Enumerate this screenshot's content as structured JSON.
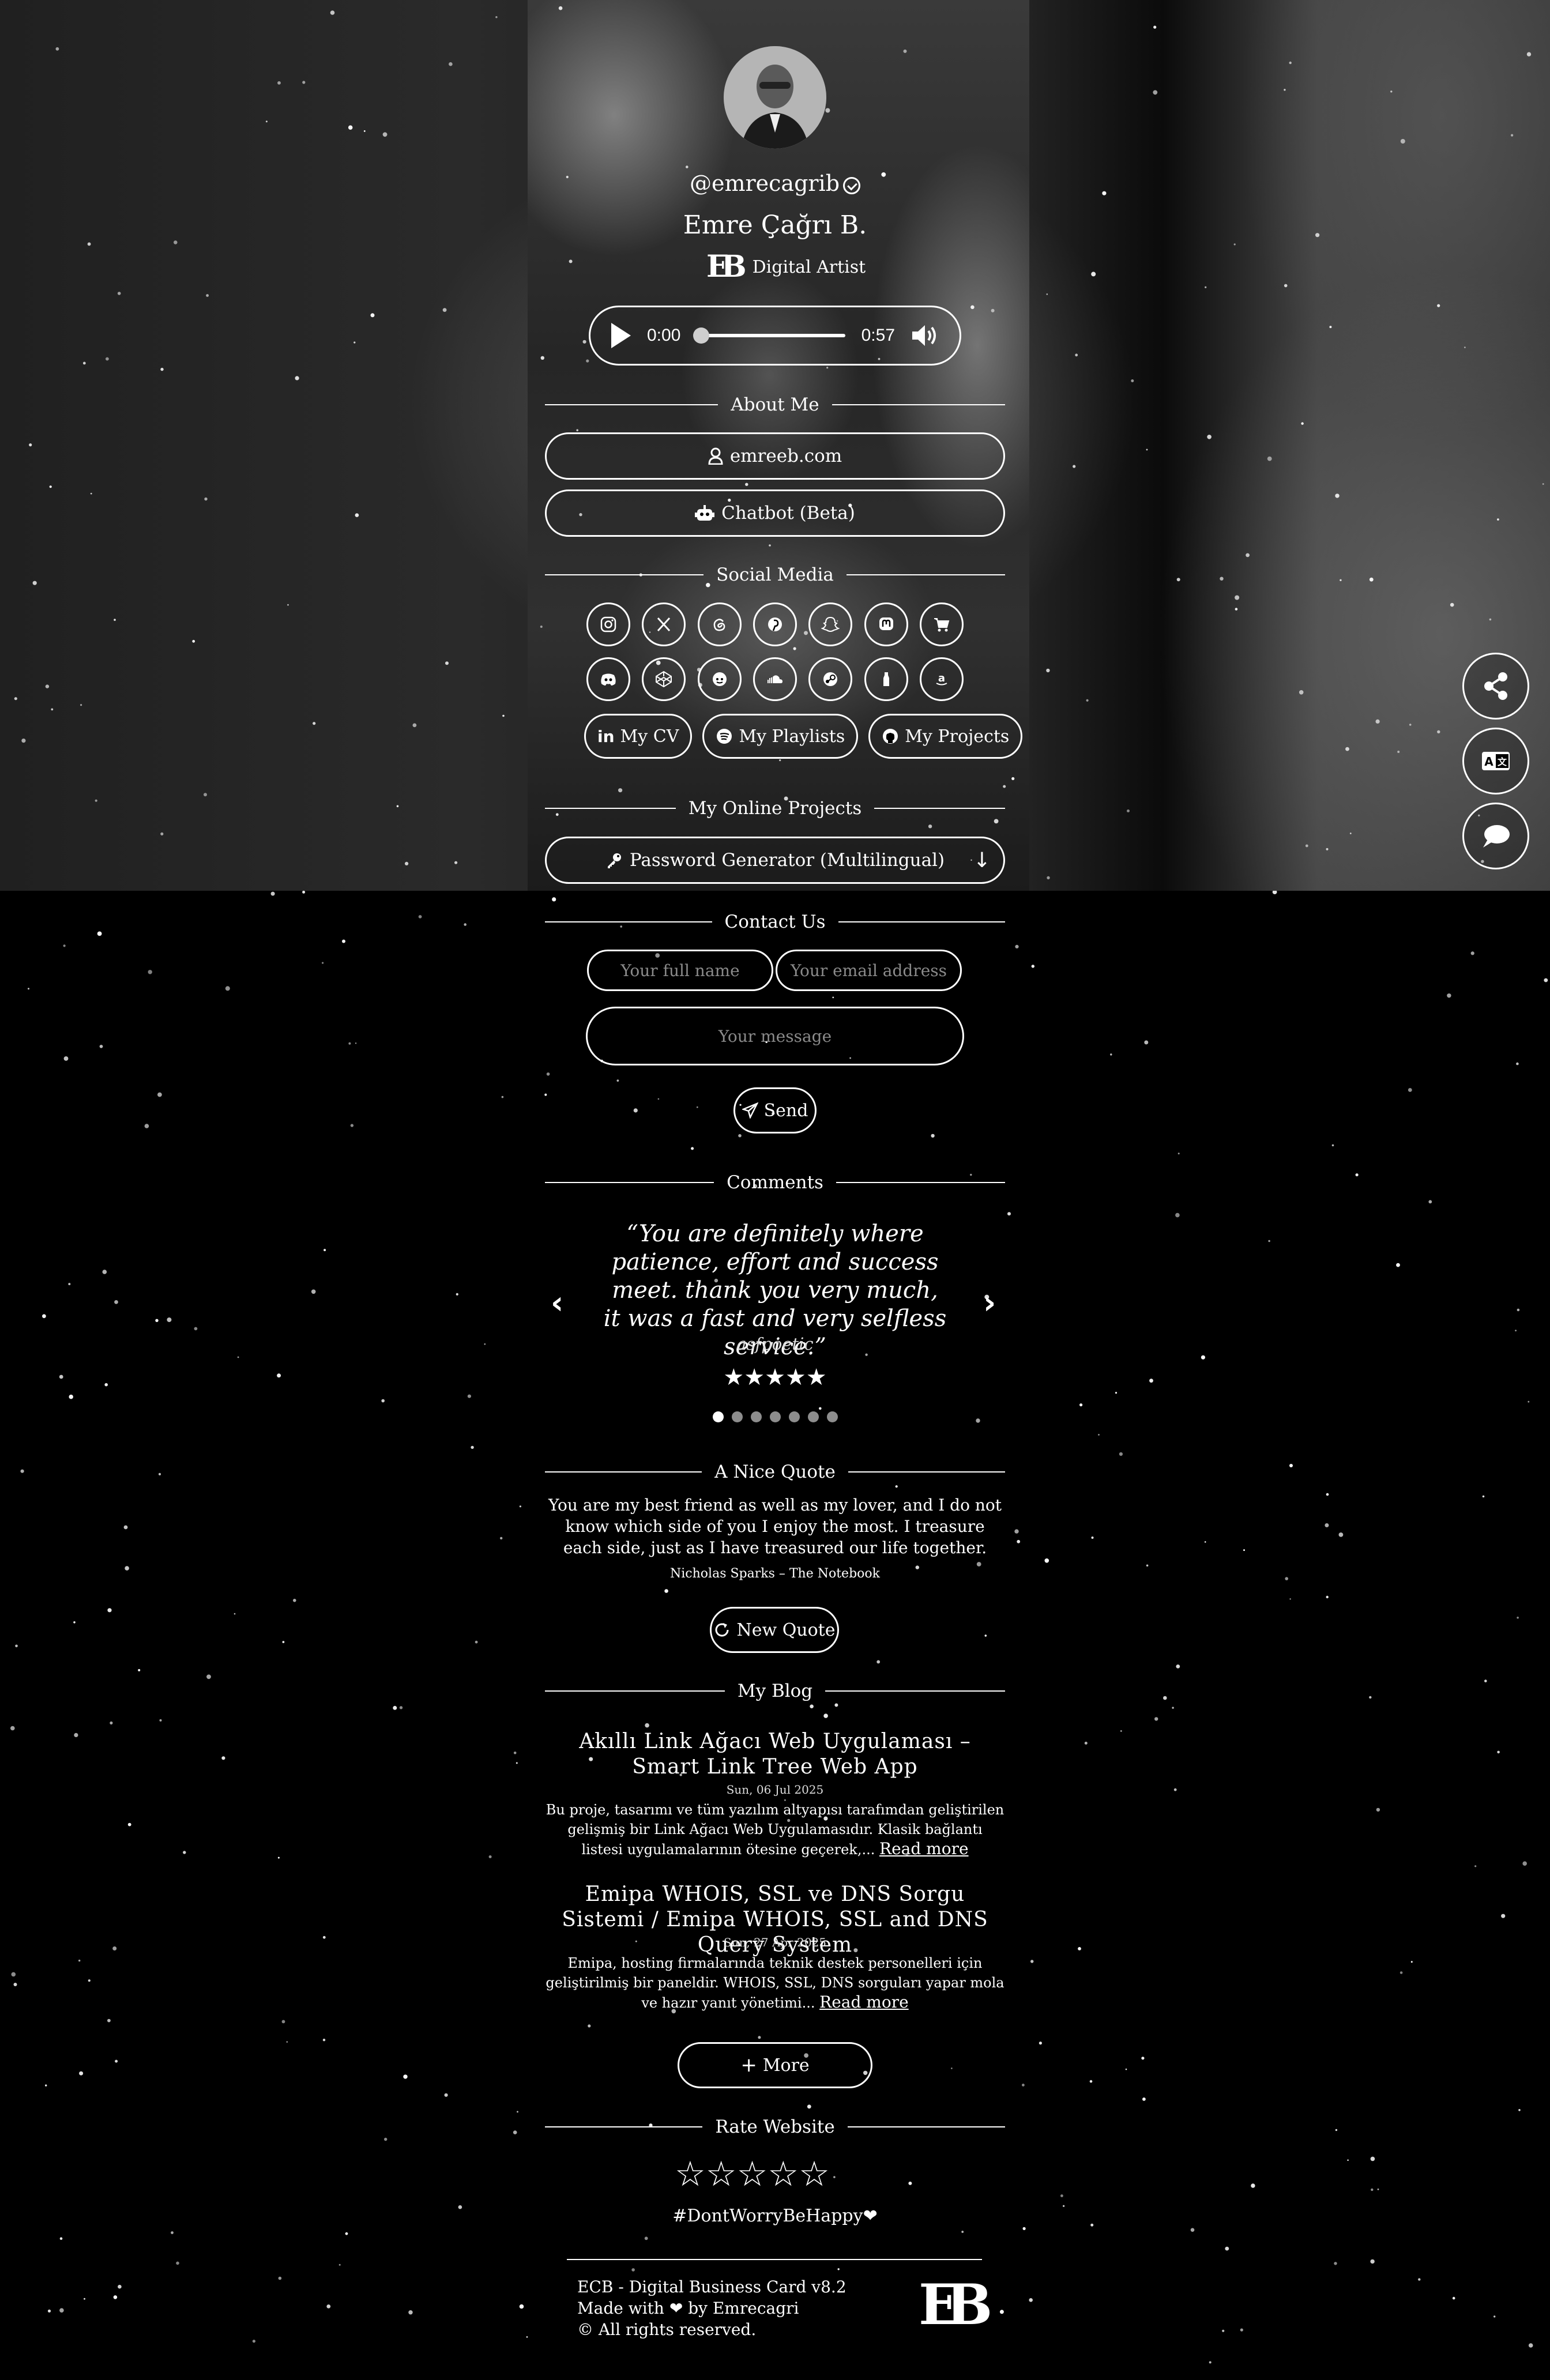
{
  "profile": {
    "username": "@emrecagrib",
    "name": "Emre Çağrı B.",
    "monogram": "EB",
    "title": "Digital Artist"
  },
  "player": {
    "current_time": "0:00",
    "duration": "0:57",
    "progress": 0
  },
  "sections": {
    "about": "About Me",
    "social": "Social Media",
    "projects": "My Online Projects",
    "contact": "Contact Us",
    "comments": "Comments",
    "quote": "A Nice Quote",
    "blog": "My Blog",
    "rate": "Rate Website"
  },
  "about_links": [
    {
      "icon": "user-icon",
      "label": "emreeb.com"
    },
    {
      "icon": "robot-icon",
      "label": "Chatbot (Beta)"
    }
  ],
  "social_icons_row1": [
    "instagram-icon",
    "x-icon",
    "threads-icon",
    "pinterest-icon",
    "snapchat-icon",
    "mastodon-icon",
    "shopping-cart-icon"
  ],
  "social_icons_row2": [
    "discord-icon",
    "codepen-icon",
    "reddit-icon",
    "soundcloud-icon",
    "steam-icon",
    "untappd-icon",
    "amazon-icon"
  ],
  "social_buttons": [
    {
      "icon": "linkedin-icon",
      "label": "My CV"
    },
    {
      "icon": "spotify-icon",
      "label": "My Playlists"
    },
    {
      "icon": "github-icon",
      "label": "My Projects"
    }
  ],
  "project": {
    "icon": "key-icon",
    "label": "Password Generator (Multilingual)",
    "toggle_icon": "arrow-down-icon"
  },
  "contact": {
    "name_placeholder": "Your full name",
    "email_placeholder": "Your email address",
    "message_placeholder": "Your message",
    "send_label": "Send"
  },
  "comment": {
    "text": "“You are definitely where patience, effort and success meet. thank you very much, it was a fast and very selfless service.”",
    "author": "asfpoetic",
    "rating": 5,
    "stars": "★★★★★",
    "slide_count": 7,
    "active_slide": 1,
    "prev": "‹",
    "next": "›"
  },
  "quote": {
    "text": "You are my best friend as well as my lover, and I do not know which side of you I enjoy the most. I treasure each side, just as I have treasured our life together.",
    "source": "Nicholas Sparks – The Notebook",
    "button": "New Quote"
  },
  "blog": {
    "posts": [
      {
        "title": "Akıllı Link Ağacı Web Uygulaması – Smart Link Tree Web App",
        "date": "Sun, 06 Jul 2025",
        "excerpt": "Bu proje, tasarımı ve tüm yazılım altyapısı tarafımdan geliştirilen gelişmiş bir Link Ağacı Web Uygulamasıdır. Klasik bağlantı listesi uygulamalarının ötesine geçerek,...",
        "read_more": "Read more"
      },
      {
        "title": "Emipa WHOIS, SSL ve DNS Sorgu Sistemi / Emipa WHOIS, SSL and DNS Query System",
        "date": "Sun, 27 Apr 2025",
        "excerpt": "Emipa, hosting firmalarında teknik destek personelleri için geliştirilmiş bir paneldir. WHOIS, SSL, DNS sorguları yapar mola ve hazır yanıt yönetimi...",
        "read_more": "Read more"
      }
    ],
    "more_label": "More"
  },
  "rating": {
    "stars": "☆☆☆☆☆",
    "value": 0
  },
  "hashtag": "#DontWorryBeHappy❤",
  "footer": {
    "line1": "ECB - Digital Business Card v8.2",
    "line2": "Made with ❤ by Emrecagri",
    "line3": "© All rights reserved."
  },
  "floating_buttons": [
    "share-icon",
    "translate-icon",
    "chat-icon"
  ]
}
